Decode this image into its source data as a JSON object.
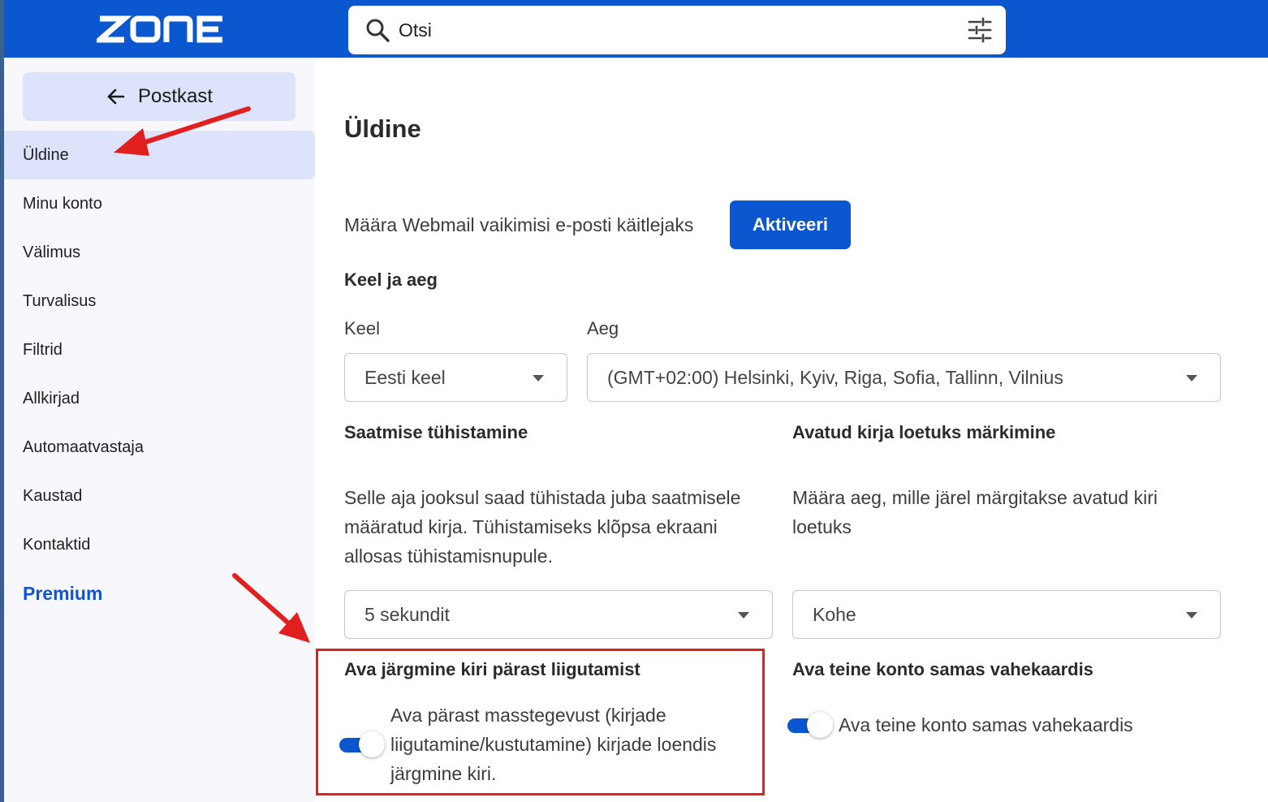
{
  "header": {
    "logo_text": "ZONE",
    "search": {
      "placeholder": "Otsi"
    }
  },
  "sidebar": {
    "back_label": "Postkast",
    "items": [
      {
        "label": "Üldine",
        "active": true
      },
      {
        "label": "Minu konto"
      },
      {
        "label": "Välimus"
      },
      {
        "label": "Turvalisus"
      },
      {
        "label": "Filtrid"
      },
      {
        "label": "Allkirjad"
      },
      {
        "label": "Automaatvastaja"
      },
      {
        "label": "Kaustad"
      },
      {
        "label": "Kontaktid"
      }
    ],
    "premium_label": "Premium"
  },
  "main": {
    "title": "Üldine",
    "default_handler": {
      "text": "Määra Webmail vaikimisi e-posti käitlejaks",
      "button_label": "Aktiveeri"
    },
    "language_time": {
      "heading": "Keel ja aeg",
      "language_label": "Keel",
      "language_value": "Eesti keel",
      "time_label": "Aeg",
      "time_value": "(GMT+02:00) Helsinki, Kyiv, Riga, Sofia, Tallinn, Vilnius"
    },
    "undo_send": {
      "heading": "Saatmise tühistamine",
      "description_lines": [
        "Selle aja jooksul saad tühistada juba saatmisele",
        "määratud kirja. Tühistamiseks klõpsa ekraani",
        "allosas tühistamisnupule."
      ],
      "value": "5 sekundit"
    },
    "mark_read": {
      "heading": "Avatud kirja loetuks märkimine",
      "description_lines": [
        "Määra aeg, mille järel märgitakse avatud kiri",
        "loetuks"
      ],
      "value": "Kohe"
    },
    "open_next": {
      "heading": "Ava järgmine kiri pärast liigutamist",
      "toggle_lines": [
        "Ava pärast masstegevust (kirjade",
        "liigutamine/kustutamine) kirjade loendis",
        "järgmine kiri."
      ],
      "enabled": true
    },
    "other_account": {
      "heading": "Ava teine konto samas vahekaardis",
      "toggle_label": "Ava teine konto samas vahekaardis",
      "enabled": true
    }
  },
  "colors": {
    "brand_blue": "#0b57d0",
    "sidebar_bg": "#f7f7fc",
    "active_bg": "#dde3fb",
    "annotation_red": "#e21f1f"
  }
}
